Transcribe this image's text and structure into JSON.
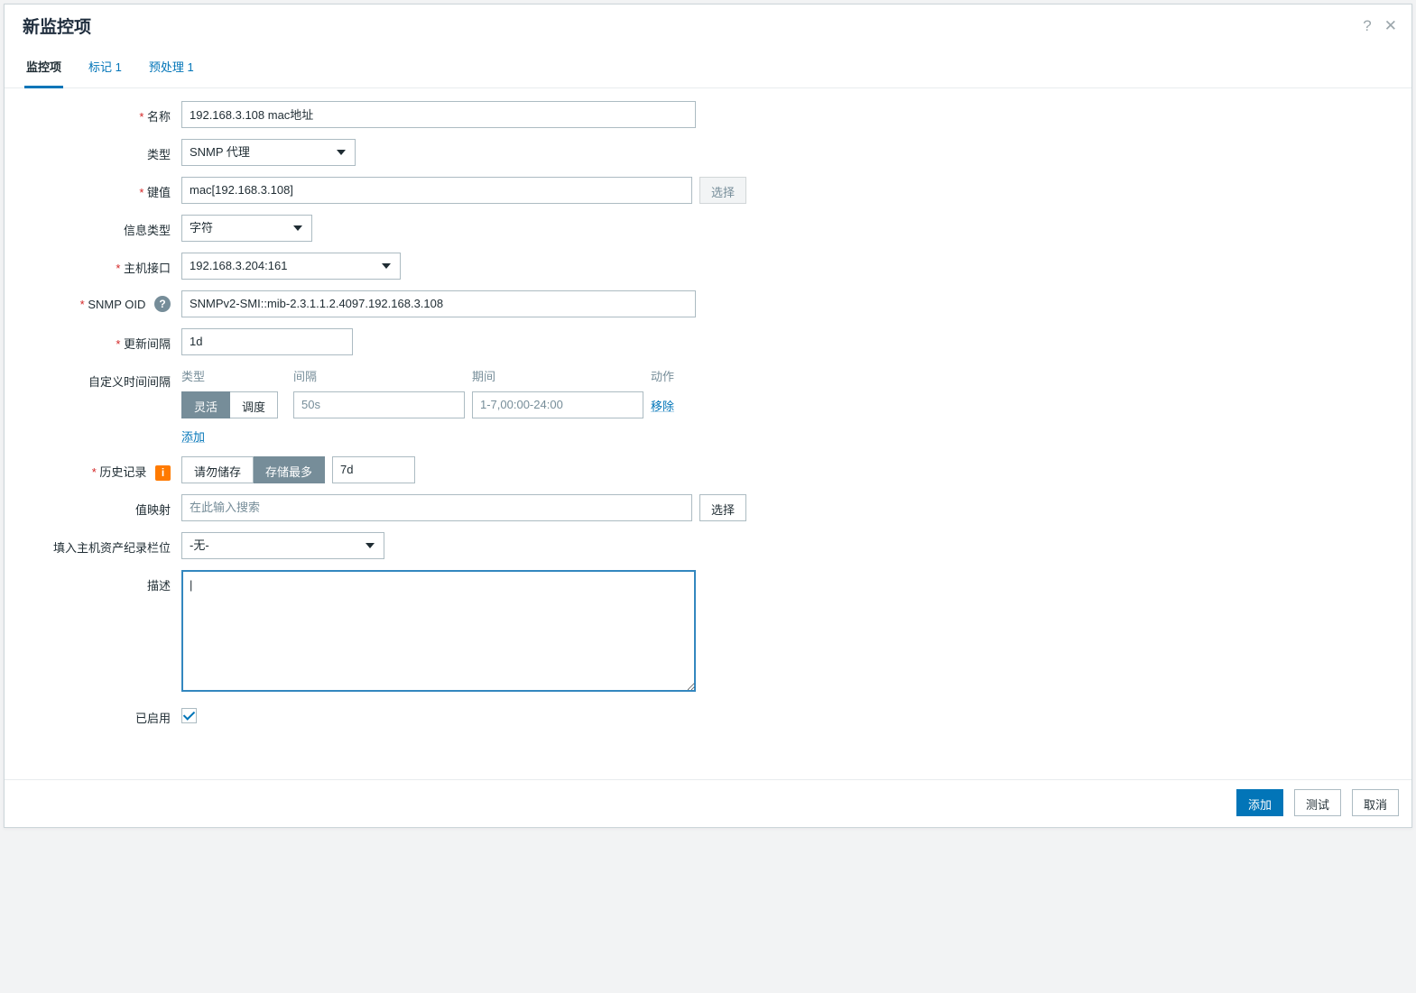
{
  "title": "新监控项",
  "tabs": [
    {
      "key": "item",
      "label": "监控项",
      "active": true
    },
    {
      "key": "tags",
      "label": "标记",
      "badge": "1"
    },
    {
      "key": "preprocessing",
      "label": "预处理",
      "badge": "1"
    }
  ],
  "labels": {
    "name": "名称",
    "type": "类型",
    "key": "键值",
    "info_type": "信息类型",
    "host_interface": "主机接口",
    "snmp_oid": "SNMP OID",
    "update_interval": "更新间隔",
    "custom_intervals": "自定义时间间隔",
    "history": "历史记录",
    "valuemap": "值映射",
    "inventory": "填入主机资产纪录栏位",
    "description": "描述",
    "enabled": "已启用"
  },
  "fields": {
    "name": "192.168.3.108 mac地址",
    "type": "SNMP 代理",
    "key": "mac[192.168.3.108]",
    "info_type": "字符",
    "host_interface": "192.168.3.204:161",
    "snmp_oid": "SNMPv2-SMI::mib-2.3.1.1.2.4097.192.168.3.108",
    "update_interval": "1d",
    "history_period": "7d",
    "inventory": "-无-",
    "description": "",
    "enabled": true
  },
  "custom_intervals": {
    "headers": {
      "type": "类型",
      "gap": "间隔",
      "period": "期间",
      "action": "动作"
    },
    "row": {
      "flexible": "灵活",
      "scheduling": "调度",
      "gap_placeholder": "50s",
      "period_placeholder": "1-7,00:00-24:00",
      "remove": "移除"
    },
    "add": "添加"
  },
  "history": {
    "no_store": "请勿储存",
    "store_more": "存储最多"
  },
  "buttons": {
    "select": "选择",
    "select_disabled": "选择",
    "add": "添加",
    "test": "测试",
    "cancel": "取消"
  },
  "placeholders": {
    "valuemap_search": "在此输入搜索"
  }
}
